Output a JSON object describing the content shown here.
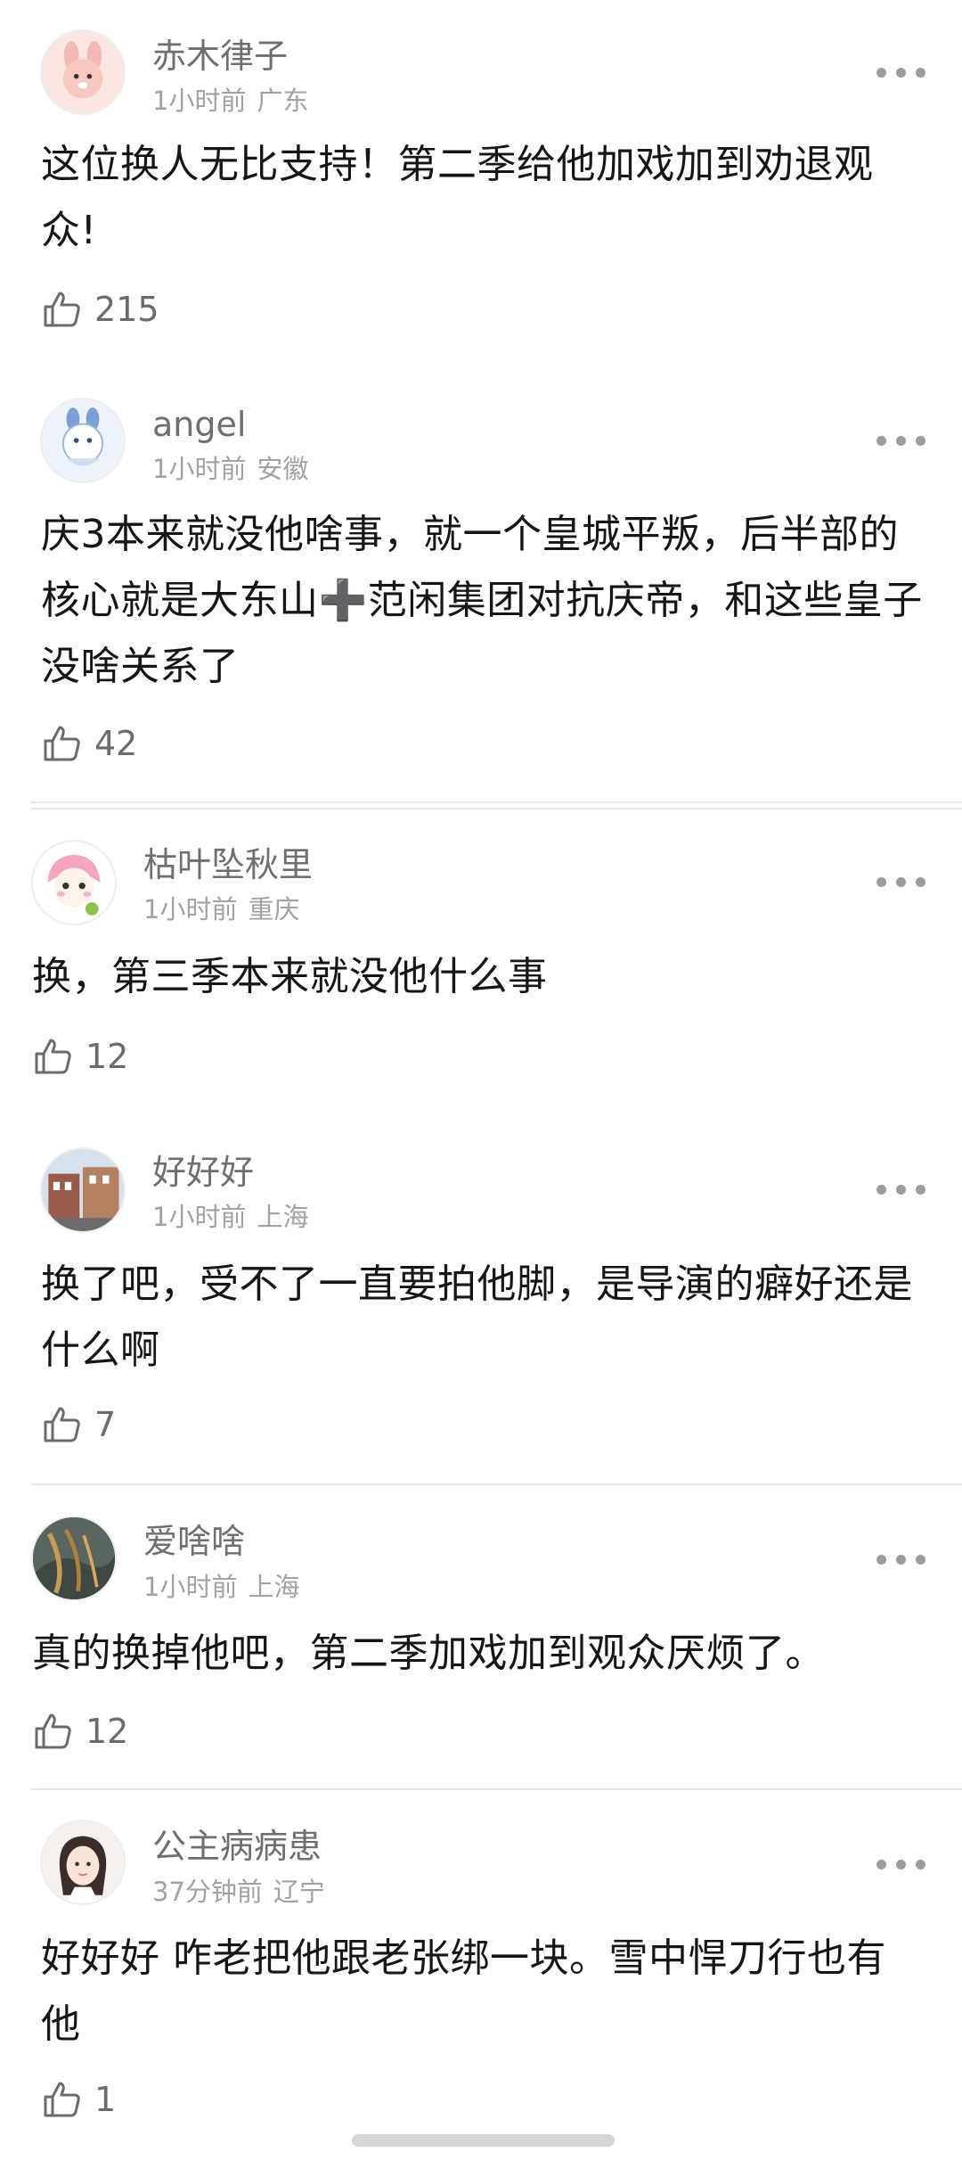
{
  "comments": [
    {
      "username": "赤木律子",
      "time": "1小时前",
      "location": "广东",
      "text": "这位换人无比支持！第二季给他加戏加到劝退观众!",
      "likes": "215"
    },
    {
      "username": "angel",
      "time": "1小时前",
      "location": "安徽",
      "text": "庆3本来就没他啥事，就一个皇城平叛，后半部的核心就是大东山➕范闲集团对抗庆帝，和这些皇子没啥关系了",
      "likes": "42"
    },
    {
      "username": "枯叶坠秋里",
      "time": "1小时前",
      "location": "重庆",
      "text": "换，第三季本来就没他什么事",
      "likes": "12"
    },
    {
      "username": "好好好",
      "time": "1小时前",
      "location": "上海",
      "text": "换了吧，受不了一直要拍他脚，是导演的癖好还是什么啊",
      "likes": "7"
    },
    {
      "username": "爱啥啥",
      "time": "1小时前",
      "location": "上海",
      "text": "真的换掉他吧，第二季加戏加到观众厌烦了。",
      "likes": "12"
    },
    {
      "username": "公主病病患",
      "time": "37分钟前",
      "location": "辽宁",
      "text": "好好好 咋老把他跟老张绑一块。雪中悍刀行也有他",
      "likes": "1"
    }
  ]
}
